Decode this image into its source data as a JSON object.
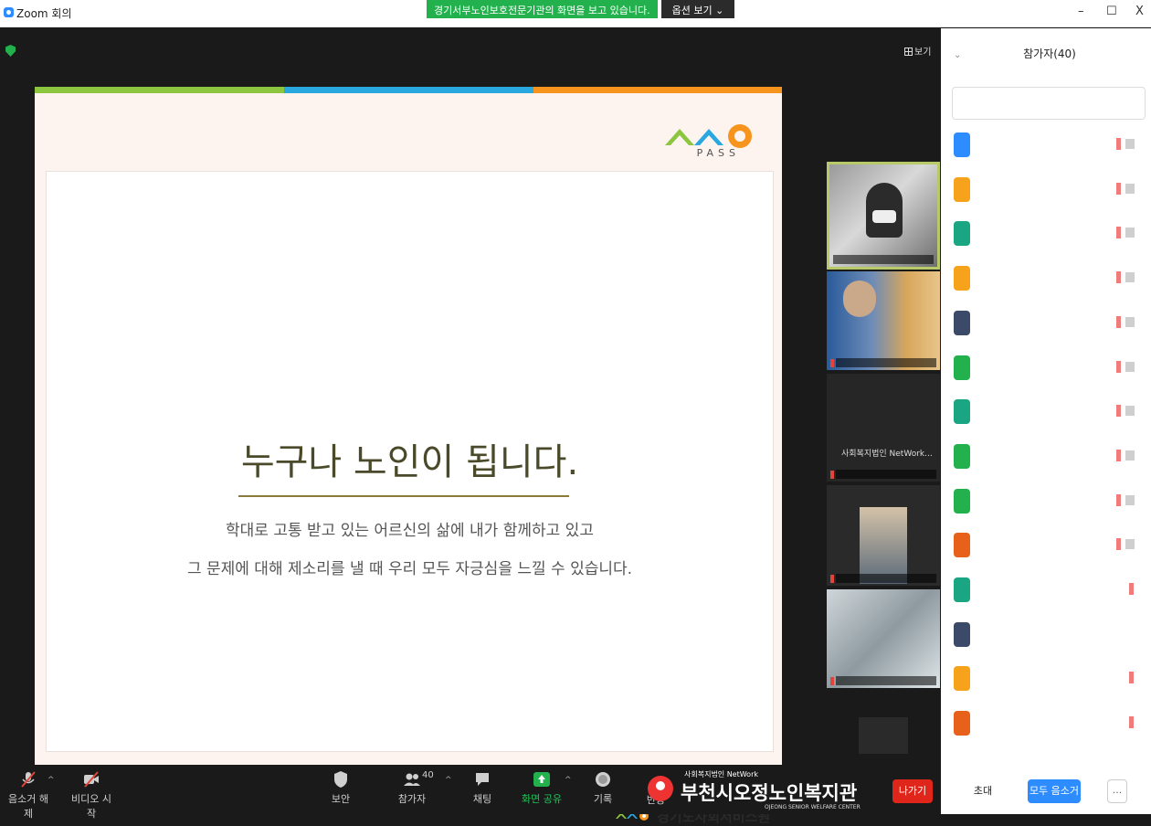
{
  "window": {
    "title": "Zoom 회의",
    "minimize": "–",
    "maximize": "☐",
    "close": "X"
  },
  "share_banner": {
    "text": "경기서부노인보호전문기관의 화면을 보고 있습니다.",
    "options": "옵션 보기 ⌄"
  },
  "view_button": "보기",
  "slide": {
    "logo_text": "PASS",
    "headline": "누구나 노인이 됩니다.",
    "line1": "학대로 고통 받고 있는 어르신의 삶에 내가 함께하고 있고",
    "line2": "그 문제에 대해 제소리를 낼 때 우리 모두 자긍심을 느낄 수 있습니다.",
    "footer_org": "경기도사회서비스원",
    "footer_mini": "PASS",
    "bar_colors": [
      "#8cc63f",
      "#29a8e0",
      "#f7941d"
    ]
  },
  "thumbnails": [
    {
      "overlay": ""
    },
    {
      "overlay": ""
    },
    {
      "overlay": "사회복지법인 NetWork..."
    },
    {
      "overlay": ""
    },
    {
      "overlay": ""
    }
  ],
  "toolbar": {
    "mute": "음소거 해제",
    "video": "비디오 시작",
    "security": "보안",
    "participants": "참가자",
    "participants_count": "40",
    "chat": "채팅",
    "share": "화면 공유",
    "record": "기록",
    "reactions": "반응",
    "leave": "나가기"
  },
  "watermark": {
    "small": "사회복지법인 NetWork",
    "big": "부천시오정노인복지관",
    "eng": "OJEONG SENIOR WELFARE CENTER"
  },
  "panel": {
    "title": "참가자(40)",
    "search_placeholder": "",
    "invite": "초대",
    "mute_all": "모두 음소거",
    "more": "..."
  },
  "participants": [
    {
      "color": "#2d8cff",
      "mic": true,
      "video": true
    },
    {
      "color": "#f7a21b",
      "mic": true,
      "video": true
    },
    {
      "color": "#1aa683",
      "mic": true,
      "video": true
    },
    {
      "color": "#f7a21b",
      "mic": true,
      "video": true
    },
    {
      "color": "#3b4a68",
      "mic": true,
      "video": true
    },
    {
      "color": "#23b14d",
      "mic": true,
      "video": true
    },
    {
      "color": "#1aa683",
      "mic": true,
      "video": true
    },
    {
      "color": "#23b14d",
      "mic": true,
      "video": true
    },
    {
      "color": "#23b14d",
      "mic": true,
      "video": true
    },
    {
      "color": "#e8611a",
      "mic": true,
      "video": true
    },
    {
      "color": "#1aa683",
      "mic": true,
      "video": false
    },
    {
      "color": "#3b4a68",
      "mic": false,
      "video": false
    },
    {
      "color": "#f7a21b",
      "mic": true,
      "video": false
    },
    {
      "color": "#e8611a",
      "mic": true,
      "video": false
    }
  ]
}
